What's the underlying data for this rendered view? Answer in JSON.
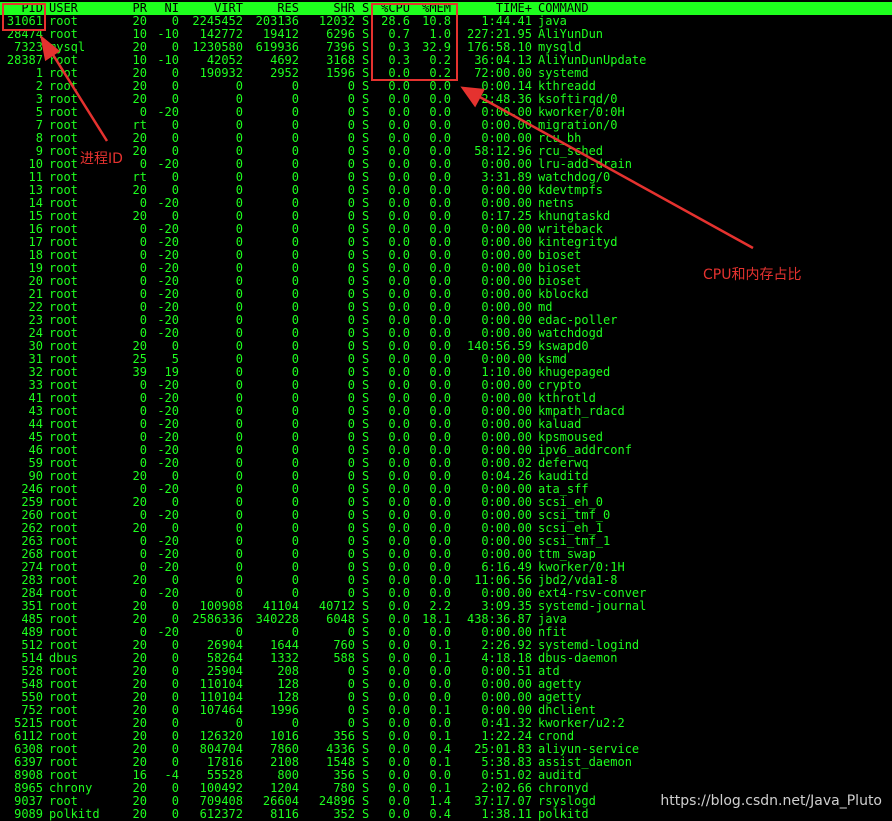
{
  "headers": {
    "pid": "PID",
    "user": "USER",
    "pr": "PR",
    "ni": "NI",
    "virt": "VIRT",
    "res": "RES",
    "shr": "SHR",
    "s": "S",
    "cpu": "%CPU",
    "mem": "%MEM",
    "time": "TIME+",
    "command": "COMMAND"
  },
  "processes": [
    {
      "pid": "31061",
      "user": "root",
      "pr": "20",
      "ni": "0",
      "virt": "2245452",
      "res": "203136",
      "shr": "12032",
      "s": "S",
      "cpu": "28.6",
      "mem": "10.8",
      "time": "1:44.41",
      "command": "java"
    },
    {
      "pid": "28474",
      "user": "root",
      "pr": "10",
      "ni": "-10",
      "virt": "142772",
      "res": "19412",
      "shr": "6296",
      "s": "S",
      "cpu": "0.7",
      "mem": "1.0",
      "time": "227:21.95",
      "command": "AliYunDun"
    },
    {
      "pid": "7323",
      "user": "mysql",
      "pr": "20",
      "ni": "0",
      "virt": "1230580",
      "res": "619936",
      "shr": "7396",
      "s": "S",
      "cpu": "0.3",
      "mem": "32.9",
      "time": "176:58.10",
      "command": "mysqld"
    },
    {
      "pid": "28387",
      "user": "root",
      "pr": "10",
      "ni": "-10",
      "virt": "42052",
      "res": "4692",
      "shr": "3168",
      "s": "S",
      "cpu": "0.3",
      "mem": "0.2",
      "time": "36:04.13",
      "command": "AliYunDunUpdate"
    },
    {
      "pid": "1",
      "user": "root",
      "pr": "20",
      "ni": "0",
      "virt": "190932",
      "res": "2952",
      "shr": "1596",
      "s": "S",
      "cpu": "0.0",
      "mem": "0.2",
      "time": "72:00.00",
      "command": "systemd"
    },
    {
      "pid": "2",
      "user": "root",
      "pr": "20",
      "ni": "0",
      "virt": "0",
      "res": "0",
      "shr": "0",
      "s": "S",
      "cpu": "0.0",
      "mem": "0.0",
      "time": "0:00.14",
      "command": "kthreadd"
    },
    {
      "pid": "3",
      "user": "root",
      "pr": "20",
      "ni": "0",
      "virt": "0",
      "res": "0",
      "shr": "0",
      "s": "S",
      "cpu": "0.0",
      "mem": "0.0",
      "time": "2:48.36",
      "command": "ksoftirqd/0"
    },
    {
      "pid": "5",
      "user": "root",
      "pr": "0",
      "ni": "-20",
      "virt": "0",
      "res": "0",
      "shr": "0",
      "s": "S",
      "cpu": "0.0",
      "mem": "0.0",
      "time": "0:00.00",
      "command": "kworker/0:0H"
    },
    {
      "pid": "7",
      "user": "root",
      "pr": "rt",
      "ni": "0",
      "virt": "0",
      "res": "0",
      "shr": "0",
      "s": "S",
      "cpu": "0.0",
      "mem": "0.0",
      "time": "0:00.00",
      "command": "migration/0"
    },
    {
      "pid": "8",
      "user": "root",
      "pr": "20",
      "ni": "0",
      "virt": "0",
      "res": "0",
      "shr": "0",
      "s": "S",
      "cpu": "0.0",
      "mem": "0.0",
      "time": "0:00.00",
      "command": "rcu_bh"
    },
    {
      "pid": "9",
      "user": "root",
      "pr": "20",
      "ni": "0",
      "virt": "0",
      "res": "0",
      "shr": "0",
      "s": "S",
      "cpu": "0.0",
      "mem": "0.0",
      "time": "58:12.96",
      "command": "rcu_sched"
    },
    {
      "pid": "10",
      "user": "root",
      "pr": "0",
      "ni": "-20",
      "virt": "0",
      "res": "0",
      "shr": "0",
      "s": "S",
      "cpu": "0.0",
      "mem": "0.0",
      "time": "0:00.00",
      "command": "lru-add-drain"
    },
    {
      "pid": "11",
      "user": "root",
      "pr": "rt",
      "ni": "0",
      "virt": "0",
      "res": "0",
      "shr": "0",
      "s": "S",
      "cpu": "0.0",
      "mem": "0.0",
      "time": "3:31.89",
      "command": "watchdog/0"
    },
    {
      "pid": "13",
      "user": "root",
      "pr": "20",
      "ni": "0",
      "virt": "0",
      "res": "0",
      "shr": "0",
      "s": "S",
      "cpu": "0.0",
      "mem": "0.0",
      "time": "0:00.00",
      "command": "kdevtmpfs"
    },
    {
      "pid": "14",
      "user": "root",
      "pr": "0",
      "ni": "-20",
      "virt": "0",
      "res": "0",
      "shr": "0",
      "s": "S",
      "cpu": "0.0",
      "mem": "0.0",
      "time": "0:00.00",
      "command": "netns"
    },
    {
      "pid": "15",
      "user": "root",
      "pr": "20",
      "ni": "0",
      "virt": "0",
      "res": "0",
      "shr": "0",
      "s": "S",
      "cpu": "0.0",
      "mem": "0.0",
      "time": "0:17.25",
      "command": "khungtaskd"
    },
    {
      "pid": "16",
      "user": "root",
      "pr": "0",
      "ni": "-20",
      "virt": "0",
      "res": "0",
      "shr": "0",
      "s": "S",
      "cpu": "0.0",
      "mem": "0.0",
      "time": "0:00.00",
      "command": "writeback"
    },
    {
      "pid": "17",
      "user": "root",
      "pr": "0",
      "ni": "-20",
      "virt": "0",
      "res": "0",
      "shr": "0",
      "s": "S",
      "cpu": "0.0",
      "mem": "0.0",
      "time": "0:00.00",
      "command": "kintegrityd"
    },
    {
      "pid": "18",
      "user": "root",
      "pr": "0",
      "ni": "-20",
      "virt": "0",
      "res": "0",
      "shr": "0",
      "s": "S",
      "cpu": "0.0",
      "mem": "0.0",
      "time": "0:00.00",
      "command": "bioset"
    },
    {
      "pid": "19",
      "user": "root",
      "pr": "0",
      "ni": "-20",
      "virt": "0",
      "res": "0",
      "shr": "0",
      "s": "S",
      "cpu": "0.0",
      "mem": "0.0",
      "time": "0:00.00",
      "command": "bioset"
    },
    {
      "pid": "20",
      "user": "root",
      "pr": "0",
      "ni": "-20",
      "virt": "0",
      "res": "0",
      "shr": "0",
      "s": "S",
      "cpu": "0.0",
      "mem": "0.0",
      "time": "0:00.00",
      "command": "bioset"
    },
    {
      "pid": "21",
      "user": "root",
      "pr": "0",
      "ni": "-20",
      "virt": "0",
      "res": "0",
      "shr": "0",
      "s": "S",
      "cpu": "0.0",
      "mem": "0.0",
      "time": "0:00.00",
      "command": "kblockd"
    },
    {
      "pid": "22",
      "user": "root",
      "pr": "0",
      "ni": "-20",
      "virt": "0",
      "res": "0",
      "shr": "0",
      "s": "S",
      "cpu": "0.0",
      "mem": "0.0",
      "time": "0:00.00",
      "command": "md"
    },
    {
      "pid": "23",
      "user": "root",
      "pr": "0",
      "ni": "-20",
      "virt": "0",
      "res": "0",
      "shr": "0",
      "s": "S",
      "cpu": "0.0",
      "mem": "0.0",
      "time": "0:00.00",
      "command": "edac-poller"
    },
    {
      "pid": "24",
      "user": "root",
      "pr": "0",
      "ni": "-20",
      "virt": "0",
      "res": "0",
      "shr": "0",
      "s": "S",
      "cpu": "0.0",
      "mem": "0.0",
      "time": "0:00.00",
      "command": "watchdogd"
    },
    {
      "pid": "30",
      "user": "root",
      "pr": "20",
      "ni": "0",
      "virt": "0",
      "res": "0",
      "shr": "0",
      "s": "S",
      "cpu": "0.0",
      "mem": "0.0",
      "time": "140:56.59",
      "command": "kswapd0"
    },
    {
      "pid": "31",
      "user": "root",
      "pr": "25",
      "ni": "5",
      "virt": "0",
      "res": "0",
      "shr": "0",
      "s": "S",
      "cpu": "0.0",
      "mem": "0.0",
      "time": "0:00.00",
      "command": "ksmd"
    },
    {
      "pid": "32",
      "user": "root",
      "pr": "39",
      "ni": "19",
      "virt": "0",
      "res": "0",
      "shr": "0",
      "s": "S",
      "cpu": "0.0",
      "mem": "0.0",
      "time": "1:10.00",
      "command": "khugepaged"
    },
    {
      "pid": "33",
      "user": "root",
      "pr": "0",
      "ni": "-20",
      "virt": "0",
      "res": "0",
      "shr": "0",
      "s": "S",
      "cpu": "0.0",
      "mem": "0.0",
      "time": "0:00.00",
      "command": "crypto"
    },
    {
      "pid": "41",
      "user": "root",
      "pr": "0",
      "ni": "-20",
      "virt": "0",
      "res": "0",
      "shr": "0",
      "s": "S",
      "cpu": "0.0",
      "mem": "0.0",
      "time": "0:00.00",
      "command": "kthrotld"
    },
    {
      "pid": "43",
      "user": "root",
      "pr": "0",
      "ni": "-20",
      "virt": "0",
      "res": "0",
      "shr": "0",
      "s": "S",
      "cpu": "0.0",
      "mem": "0.0",
      "time": "0:00.00",
      "command": "kmpath_rdacd"
    },
    {
      "pid": "44",
      "user": "root",
      "pr": "0",
      "ni": "-20",
      "virt": "0",
      "res": "0",
      "shr": "0",
      "s": "S",
      "cpu": "0.0",
      "mem": "0.0",
      "time": "0:00.00",
      "command": "kaluad"
    },
    {
      "pid": "45",
      "user": "root",
      "pr": "0",
      "ni": "-20",
      "virt": "0",
      "res": "0",
      "shr": "0",
      "s": "S",
      "cpu": "0.0",
      "mem": "0.0",
      "time": "0:00.00",
      "command": "kpsmoused"
    },
    {
      "pid": "46",
      "user": "root",
      "pr": "0",
      "ni": "-20",
      "virt": "0",
      "res": "0",
      "shr": "0",
      "s": "S",
      "cpu": "0.0",
      "mem": "0.0",
      "time": "0:00.00",
      "command": "ipv6_addrconf"
    },
    {
      "pid": "59",
      "user": "root",
      "pr": "0",
      "ni": "-20",
      "virt": "0",
      "res": "0",
      "shr": "0",
      "s": "S",
      "cpu": "0.0",
      "mem": "0.0",
      "time": "0:00.02",
      "command": "deferwq"
    },
    {
      "pid": "90",
      "user": "root",
      "pr": "20",
      "ni": "0",
      "virt": "0",
      "res": "0",
      "shr": "0",
      "s": "S",
      "cpu": "0.0",
      "mem": "0.0",
      "time": "0:04.26",
      "command": "kauditd"
    },
    {
      "pid": "246",
      "user": "root",
      "pr": "0",
      "ni": "-20",
      "virt": "0",
      "res": "0",
      "shr": "0",
      "s": "S",
      "cpu": "0.0",
      "mem": "0.0",
      "time": "0:00.00",
      "command": "ata_sff"
    },
    {
      "pid": "259",
      "user": "root",
      "pr": "20",
      "ni": "0",
      "virt": "0",
      "res": "0",
      "shr": "0",
      "s": "S",
      "cpu": "0.0",
      "mem": "0.0",
      "time": "0:00.00",
      "command": "scsi_eh_0"
    },
    {
      "pid": "260",
      "user": "root",
      "pr": "0",
      "ni": "-20",
      "virt": "0",
      "res": "0",
      "shr": "0",
      "s": "S",
      "cpu": "0.0",
      "mem": "0.0",
      "time": "0:00.00",
      "command": "scsi_tmf_0"
    },
    {
      "pid": "262",
      "user": "root",
      "pr": "20",
      "ni": "0",
      "virt": "0",
      "res": "0",
      "shr": "0",
      "s": "S",
      "cpu": "0.0",
      "mem": "0.0",
      "time": "0:00.00",
      "command": "scsi_eh_1"
    },
    {
      "pid": "263",
      "user": "root",
      "pr": "0",
      "ni": "-20",
      "virt": "0",
      "res": "0",
      "shr": "0",
      "s": "S",
      "cpu": "0.0",
      "mem": "0.0",
      "time": "0:00.00",
      "command": "scsi_tmf_1"
    },
    {
      "pid": "268",
      "user": "root",
      "pr": "0",
      "ni": "-20",
      "virt": "0",
      "res": "0",
      "shr": "0",
      "s": "S",
      "cpu": "0.0",
      "mem": "0.0",
      "time": "0:00.00",
      "command": "ttm_swap"
    },
    {
      "pid": "274",
      "user": "root",
      "pr": "0",
      "ni": "-20",
      "virt": "0",
      "res": "0",
      "shr": "0",
      "s": "S",
      "cpu": "0.0",
      "mem": "0.0",
      "time": "6:16.49",
      "command": "kworker/0:1H"
    },
    {
      "pid": "283",
      "user": "root",
      "pr": "20",
      "ni": "0",
      "virt": "0",
      "res": "0",
      "shr": "0",
      "s": "S",
      "cpu": "0.0",
      "mem": "0.0",
      "time": "11:06.56",
      "command": "jbd2/vda1-8"
    },
    {
      "pid": "284",
      "user": "root",
      "pr": "0",
      "ni": "-20",
      "virt": "0",
      "res": "0",
      "shr": "0",
      "s": "S",
      "cpu": "0.0",
      "mem": "0.0",
      "time": "0:00.00",
      "command": "ext4-rsv-conver"
    },
    {
      "pid": "351",
      "user": "root",
      "pr": "20",
      "ni": "0",
      "virt": "100908",
      "res": "41104",
      "shr": "40712",
      "s": "S",
      "cpu": "0.0",
      "mem": "2.2",
      "time": "3:09.35",
      "command": "systemd-journal"
    },
    {
      "pid": "485",
      "user": "root",
      "pr": "20",
      "ni": "0",
      "virt": "2586336",
      "res": "340228",
      "shr": "6048",
      "s": "S",
      "cpu": "0.0",
      "mem": "18.1",
      "time": "438:36.87",
      "command": "java"
    },
    {
      "pid": "489",
      "user": "root",
      "pr": "0",
      "ni": "-20",
      "virt": "0",
      "res": "0",
      "shr": "0",
      "s": "S",
      "cpu": "0.0",
      "mem": "0.0",
      "time": "0:00.00",
      "command": "nfit"
    },
    {
      "pid": "512",
      "user": "root",
      "pr": "20",
      "ni": "0",
      "virt": "26904",
      "res": "1644",
      "shr": "760",
      "s": "S",
      "cpu": "0.0",
      "mem": "0.1",
      "time": "2:26.92",
      "command": "systemd-logind"
    },
    {
      "pid": "514",
      "user": "dbus",
      "pr": "20",
      "ni": "0",
      "virt": "58264",
      "res": "1332",
      "shr": "588",
      "s": "S",
      "cpu": "0.0",
      "mem": "0.1",
      "time": "4:18.18",
      "command": "dbus-daemon"
    },
    {
      "pid": "528",
      "user": "root",
      "pr": "20",
      "ni": "0",
      "virt": "25904",
      "res": "208",
      "shr": "0",
      "s": "S",
      "cpu": "0.0",
      "mem": "0.0",
      "time": "0:00.51",
      "command": "atd"
    },
    {
      "pid": "548",
      "user": "root",
      "pr": "20",
      "ni": "0",
      "virt": "110104",
      "res": "128",
      "shr": "0",
      "s": "S",
      "cpu": "0.0",
      "mem": "0.0",
      "time": "0:00.00",
      "command": "agetty"
    },
    {
      "pid": "550",
      "user": "root",
      "pr": "20",
      "ni": "0",
      "virt": "110104",
      "res": "128",
      "shr": "0",
      "s": "S",
      "cpu": "0.0",
      "mem": "0.0",
      "time": "0:00.00",
      "command": "agetty"
    },
    {
      "pid": "752",
      "user": "root",
      "pr": "20",
      "ni": "0",
      "virt": "107464",
      "res": "1996",
      "shr": "0",
      "s": "S",
      "cpu": "0.0",
      "mem": "0.1",
      "time": "0:00.00",
      "command": "dhclient"
    },
    {
      "pid": "5215",
      "user": "root",
      "pr": "20",
      "ni": "0",
      "virt": "0",
      "res": "0",
      "shr": "0",
      "s": "S",
      "cpu": "0.0",
      "mem": "0.0",
      "time": "0:41.32",
      "command": "kworker/u2:2"
    },
    {
      "pid": "6112",
      "user": "root",
      "pr": "20",
      "ni": "0",
      "virt": "126320",
      "res": "1016",
      "shr": "356",
      "s": "S",
      "cpu": "0.0",
      "mem": "0.1",
      "time": "1:22.24",
      "command": "crond"
    },
    {
      "pid": "6308",
      "user": "root",
      "pr": "20",
      "ni": "0",
      "virt": "804704",
      "res": "7860",
      "shr": "4336",
      "s": "S",
      "cpu": "0.0",
      "mem": "0.4",
      "time": "25:01.83",
      "command": "aliyun-service"
    },
    {
      "pid": "6397",
      "user": "root",
      "pr": "20",
      "ni": "0",
      "virt": "17816",
      "res": "2108",
      "shr": "1548",
      "s": "S",
      "cpu": "0.0",
      "mem": "0.1",
      "time": "5:38.83",
      "command": "assist_daemon"
    },
    {
      "pid": "8908",
      "user": "root",
      "pr": "16",
      "ni": "-4",
      "virt": "55528",
      "res": "800",
      "shr": "356",
      "s": "S",
      "cpu": "0.0",
      "mem": "0.0",
      "time": "0:51.02",
      "command": "auditd"
    },
    {
      "pid": "8965",
      "user": "chrony",
      "pr": "20",
      "ni": "0",
      "virt": "100492",
      "res": "1204",
      "shr": "780",
      "s": "S",
      "cpu": "0.0",
      "mem": "0.1",
      "time": "2:02.66",
      "command": "chronyd"
    },
    {
      "pid": "9037",
      "user": "root",
      "pr": "20",
      "ni": "0",
      "virt": "709408",
      "res": "26604",
      "shr": "24896",
      "s": "S",
      "cpu": "0.0",
      "mem": "1.4",
      "time": "37:17.07",
      "command": "rsyslogd"
    },
    {
      "pid": "9089",
      "user": "polkitd",
      "pr": "20",
      "ni": "0",
      "virt": "612372",
      "res": "8116",
      "shr": "352",
      "s": "S",
      "cpu": "0.0",
      "mem": "0.4",
      "time": "1:38.11",
      "command": "polkitd"
    }
  ],
  "annotations": {
    "pid_label": "进程ID",
    "cpu_mem_label": "CPU和内存占比",
    "color": "#e5322f"
  },
  "watermark": "https://blog.csdn.net/Java_Pluto",
  "colors": {
    "terminal_bg": "#000000",
    "terminal_fg": "#1eff1e",
    "header_bg": "#1eff1e",
    "header_fg": "#000000"
  }
}
